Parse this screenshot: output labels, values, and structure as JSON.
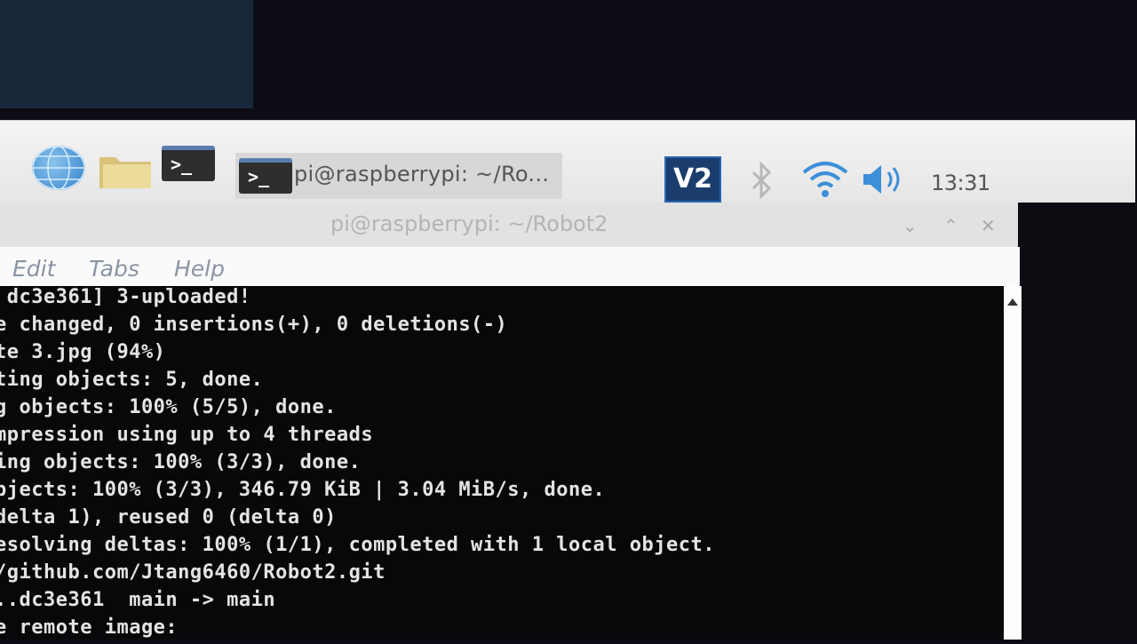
{
  "taskbar": {
    "icons": [
      "web-browser-icon",
      "file-manager-icon",
      "terminal-icon"
    ],
    "task_label": "pi@raspberrypi: ~/Ro...",
    "tray": {
      "vnc_label": "V2",
      "icons": [
        "vnc-icon",
        "bluetooth-icon",
        "wifi-icon",
        "volume-icon"
      ],
      "clock": "13:31"
    }
  },
  "window": {
    "title": "pi@raspberrypi: ~/Robot2",
    "controls": {
      "minimize": "⌄",
      "maximize": "⌃",
      "close": "✕"
    }
  },
  "menu": {
    "edit": "Edit",
    "tabs": "Tabs",
    "help": "Help"
  },
  "terminal": {
    "lines": [
      " dc3e361] 3-uploaded!",
      "e changed, 0 insertions(+), 0 deletions(-)",
      "te 3.jpg (94%)",
      "ting objects: 5, done.",
      "g objects: 100% (5/5), done.",
      "mpression using up to 4 threads",
      "ing objects: 100% (3/3), done.",
      "bjects: 100% (3/3), 346.79 KiB | 3.04 MiB/s, done.",
      "delta 1), reused 0 (delta 0)",
      "esolving deltas: 100% (1/1), completed with 1 local object.",
      "/github.com/Jtang6460/Robot2.git",
      "..dc3e361  main -> main",
      "e remote image:"
    ]
  },
  "colors": {
    "taskbar_bg": "#eeeeee",
    "terminal_bg": "#08080b",
    "terminal_fg": "#e4e4e4",
    "menu_text": "#8a95a4",
    "vnc_bg": "#1a3d6e"
  }
}
